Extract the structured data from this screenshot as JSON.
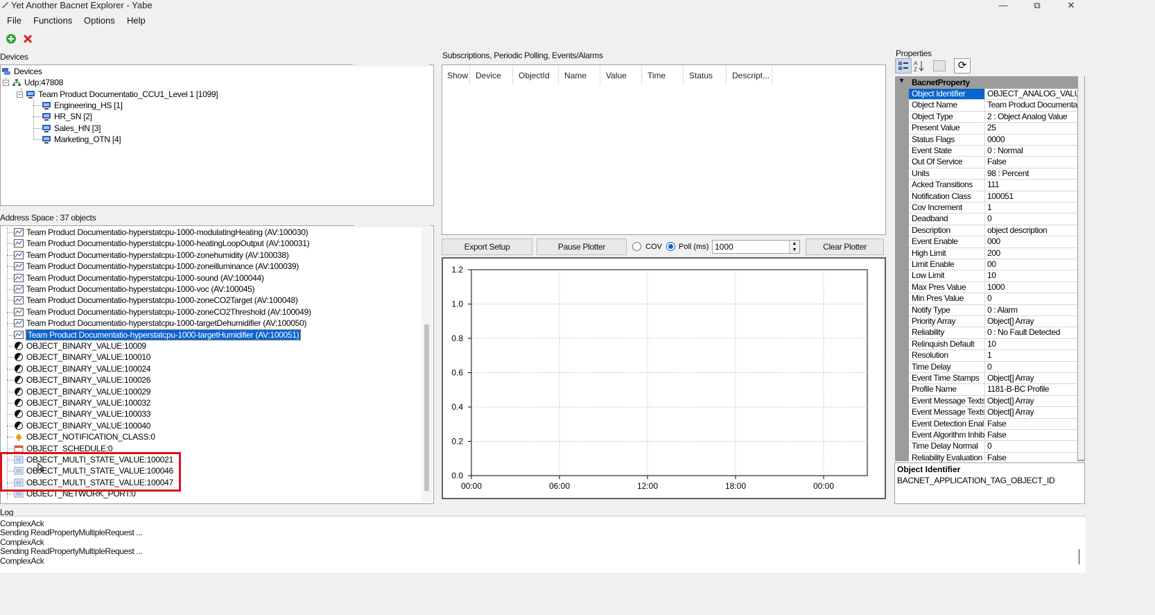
{
  "window": {
    "title": "Yet Another Bacnet Explorer - Yabe",
    "min_glyph": "—",
    "max_glyph": "⧉",
    "close_glyph": "✕"
  },
  "menu": [
    "File",
    "Functions",
    "Options",
    "Help"
  ],
  "toolbar": {
    "add_icon": "add-icon",
    "remove_icon": "remove-icon"
  },
  "devices": {
    "label": "Devices",
    "tree": [
      {
        "text": "Devices",
        "icon": "network-icon"
      },
      {
        "text": "Udp:47808",
        "icon": "network-icon"
      },
      {
        "text": "Team Product Documentatio_CCU1_Level 1 [1099]",
        "icon": "device-icon"
      },
      {
        "text": "Engineering_HS [1]",
        "icon": "device-icon"
      },
      {
        "text": "HR_SN [2]",
        "icon": "device-icon"
      },
      {
        "text": "Sales_HN [3]",
        "icon": "device-icon"
      },
      {
        "text": "Marketing_OTN [4]",
        "icon": "device-icon"
      }
    ]
  },
  "address_space": {
    "label": "Address Space : 37 objects",
    "items": [
      {
        "text": "Team Product Documentatio-hyperstatcpu-1000-modulatingHeating (AV:100030)",
        "icon": "analog-icon"
      },
      {
        "text": "Team Product Documentatio-hyperstatcpu-1000-heatingLoopOutput (AV:100031)",
        "icon": "analog-icon"
      },
      {
        "text": "Team Product Documentatio-hyperstatcpu-1000-zonehumidity (AV:100038)",
        "icon": "analog-icon"
      },
      {
        "text": "Team Product Documentatio-hyperstatcpu-1000-zoneilluminance (AV:100039)",
        "icon": "analog-icon"
      },
      {
        "text": "Team Product Documentatio-hyperstatcpu-1000-sound (AV:100044)",
        "icon": "analog-icon"
      },
      {
        "text": "Team Product Documentatio-hyperstatcpu-1000-voc (AV:100045)",
        "icon": "analog-icon"
      },
      {
        "text": "Team Product Documentatio-hyperstatcpu-1000-zoneCO2Target (AV:100048)",
        "icon": "analog-icon"
      },
      {
        "text": "Team Product Documentatio-hyperstatcpu-1000-zoneCO2Threshold (AV:100049)",
        "icon": "analog-icon"
      },
      {
        "text": "Team Product Documentatio-hyperstatcpu-1000-targetDehumidifier (AV:100050)",
        "icon": "analog-icon"
      },
      {
        "text": "Team Product Documentatio-hyperstatcpu-1000-targetHumidifier (AV:100051)",
        "icon": "analog-icon",
        "selected": true
      },
      {
        "text": "OBJECT_BINARY_VALUE:10009",
        "icon": "binary-icon"
      },
      {
        "text": "OBJECT_BINARY_VALUE:100010",
        "icon": "binary-icon"
      },
      {
        "text": "OBJECT_BINARY_VALUE:100024",
        "icon": "binary-icon"
      },
      {
        "text": "OBJECT_BINARY_VALUE:100026",
        "icon": "binary-icon"
      },
      {
        "text": "OBJECT_BINARY_VALUE:100029",
        "icon": "binary-icon"
      },
      {
        "text": "OBJECT_BINARY_VALUE:100032",
        "icon": "binary-icon"
      },
      {
        "text": "OBJECT_BINARY_VALUE:100033",
        "icon": "binary-icon"
      },
      {
        "text": "OBJECT_BINARY_VALUE:100040",
        "icon": "binary-icon"
      },
      {
        "text": "OBJECT_NOTIFICATION_CLASS:0",
        "icon": "bell-icon"
      },
      {
        "text": "OBJECT_SCHEDULE:0",
        "icon": "schedule-icon"
      },
      {
        "text": "OBJECT_MULTI_STATE_VALUE:100021",
        "icon": "multistate-icon"
      },
      {
        "text": "OBJECT_MULTI_STATE_VALUE:100046",
        "icon": "multistate-icon"
      },
      {
        "text": "OBJECT_MULTI_STATE_VALUE:100047",
        "icon": "multistate-icon"
      },
      {
        "text": "OBJECT_NETWORK_PORT:0",
        "icon": "multistate-icon"
      }
    ]
  },
  "subscriptions": {
    "label": "Subscriptions, Periodic Polling, Events/Alarms",
    "columns": [
      "Show",
      "Device",
      "ObjectId",
      "Name",
      "Value",
      "Time",
      "Status",
      "Descript..."
    ]
  },
  "plotter": {
    "export_label": "Export Setup",
    "pause_label": "Pause Plotter",
    "cov_label": "COV",
    "poll_label": "Poll (ms)",
    "poll_value": "1000",
    "clear_label": "Clear Plotter",
    "poll_selected": true
  },
  "chart_data": {
    "type": "line",
    "x_ticks": [
      "00:00",
      "06:00",
      "12:00",
      "18:00",
      "00:00"
    ],
    "y_ticks": [
      "0.0",
      "0.2",
      "0.4",
      "0.6",
      "0.8",
      "1.0",
      "1.2"
    ],
    "ylim": [
      0,
      1.2
    ],
    "series": [],
    "grid": true
  },
  "properties": {
    "label": "Properties",
    "category": "BacnetProperty",
    "rows": [
      {
        "name": "Object Identifier",
        "value": "OBJECT_ANALOG_VALU",
        "selected": true
      },
      {
        "name": "Object Name",
        "value": "Team Product Documenta"
      },
      {
        "name": "Object Type",
        "value": "2 : Object Analog Value"
      },
      {
        "name": "Present Value",
        "value": "25"
      },
      {
        "name": "Status Flags",
        "value": "0000"
      },
      {
        "name": "Event State",
        "value": "0 : Normal"
      },
      {
        "name": "Out Of Service",
        "value": "False"
      },
      {
        "name": "Units",
        "value": "98 : Percent"
      },
      {
        "name": "Acked Transitions",
        "value": "111"
      },
      {
        "name": "Notification Class",
        "value": "100051"
      },
      {
        "name": "Cov Increment",
        "value": "1"
      },
      {
        "name": "Deadband",
        "value": "0"
      },
      {
        "name": "Description",
        "value": "object description"
      },
      {
        "name": "Event Enable",
        "value": "000"
      },
      {
        "name": "High Limit",
        "value": "200"
      },
      {
        "name": "Limit Enable",
        "value": "00"
      },
      {
        "name": "Low Limit",
        "value": "10"
      },
      {
        "name": "Max Pres Value",
        "value": "1000"
      },
      {
        "name": "Min Pres Value",
        "value": "0"
      },
      {
        "name": "Notify Type",
        "value": "0 : Alarm"
      },
      {
        "name": "Priority Array",
        "value": "Object[] Array"
      },
      {
        "name": "Reliability",
        "value": "0 : No Fault Detected"
      },
      {
        "name": "Relinquish Default",
        "value": "10"
      },
      {
        "name": "Resolution",
        "value": "1"
      },
      {
        "name": "Time Delay",
        "value": "0"
      },
      {
        "name": "Event Time Stamps",
        "value": "Object[] Array"
      },
      {
        "name": "Profile Name",
        "value": "1181-B-BC Profile"
      },
      {
        "name": "Event Message Texts",
        "value": "Object[] Array"
      },
      {
        "name": "Event Message Texts",
        "value": "Object[] Array"
      },
      {
        "name": "Event Detection Enal",
        "value": "False"
      },
      {
        "name": "Event Algorithm Inhibi",
        "value": "False"
      },
      {
        "name": "Time Delay Normal",
        "value": "0"
      },
      {
        "name": "Reliability Evaluation I",
        "value": "False"
      }
    ],
    "help_title": "Object Identifier",
    "help_text": "BACNET_APPLICATION_TAG_OBJECT_ID"
  },
  "log": {
    "label": "Log",
    "lines": [
      "ComplexAck",
      "Sending ReadPropertyMultipleRequest ...",
      "ComplexAck",
      "Sending ReadPropertyMultipleRequest ...",
      "ComplexAck"
    ]
  },
  "colors": {
    "selection": "#0a63d0",
    "highlight_box": "#e0101a"
  }
}
